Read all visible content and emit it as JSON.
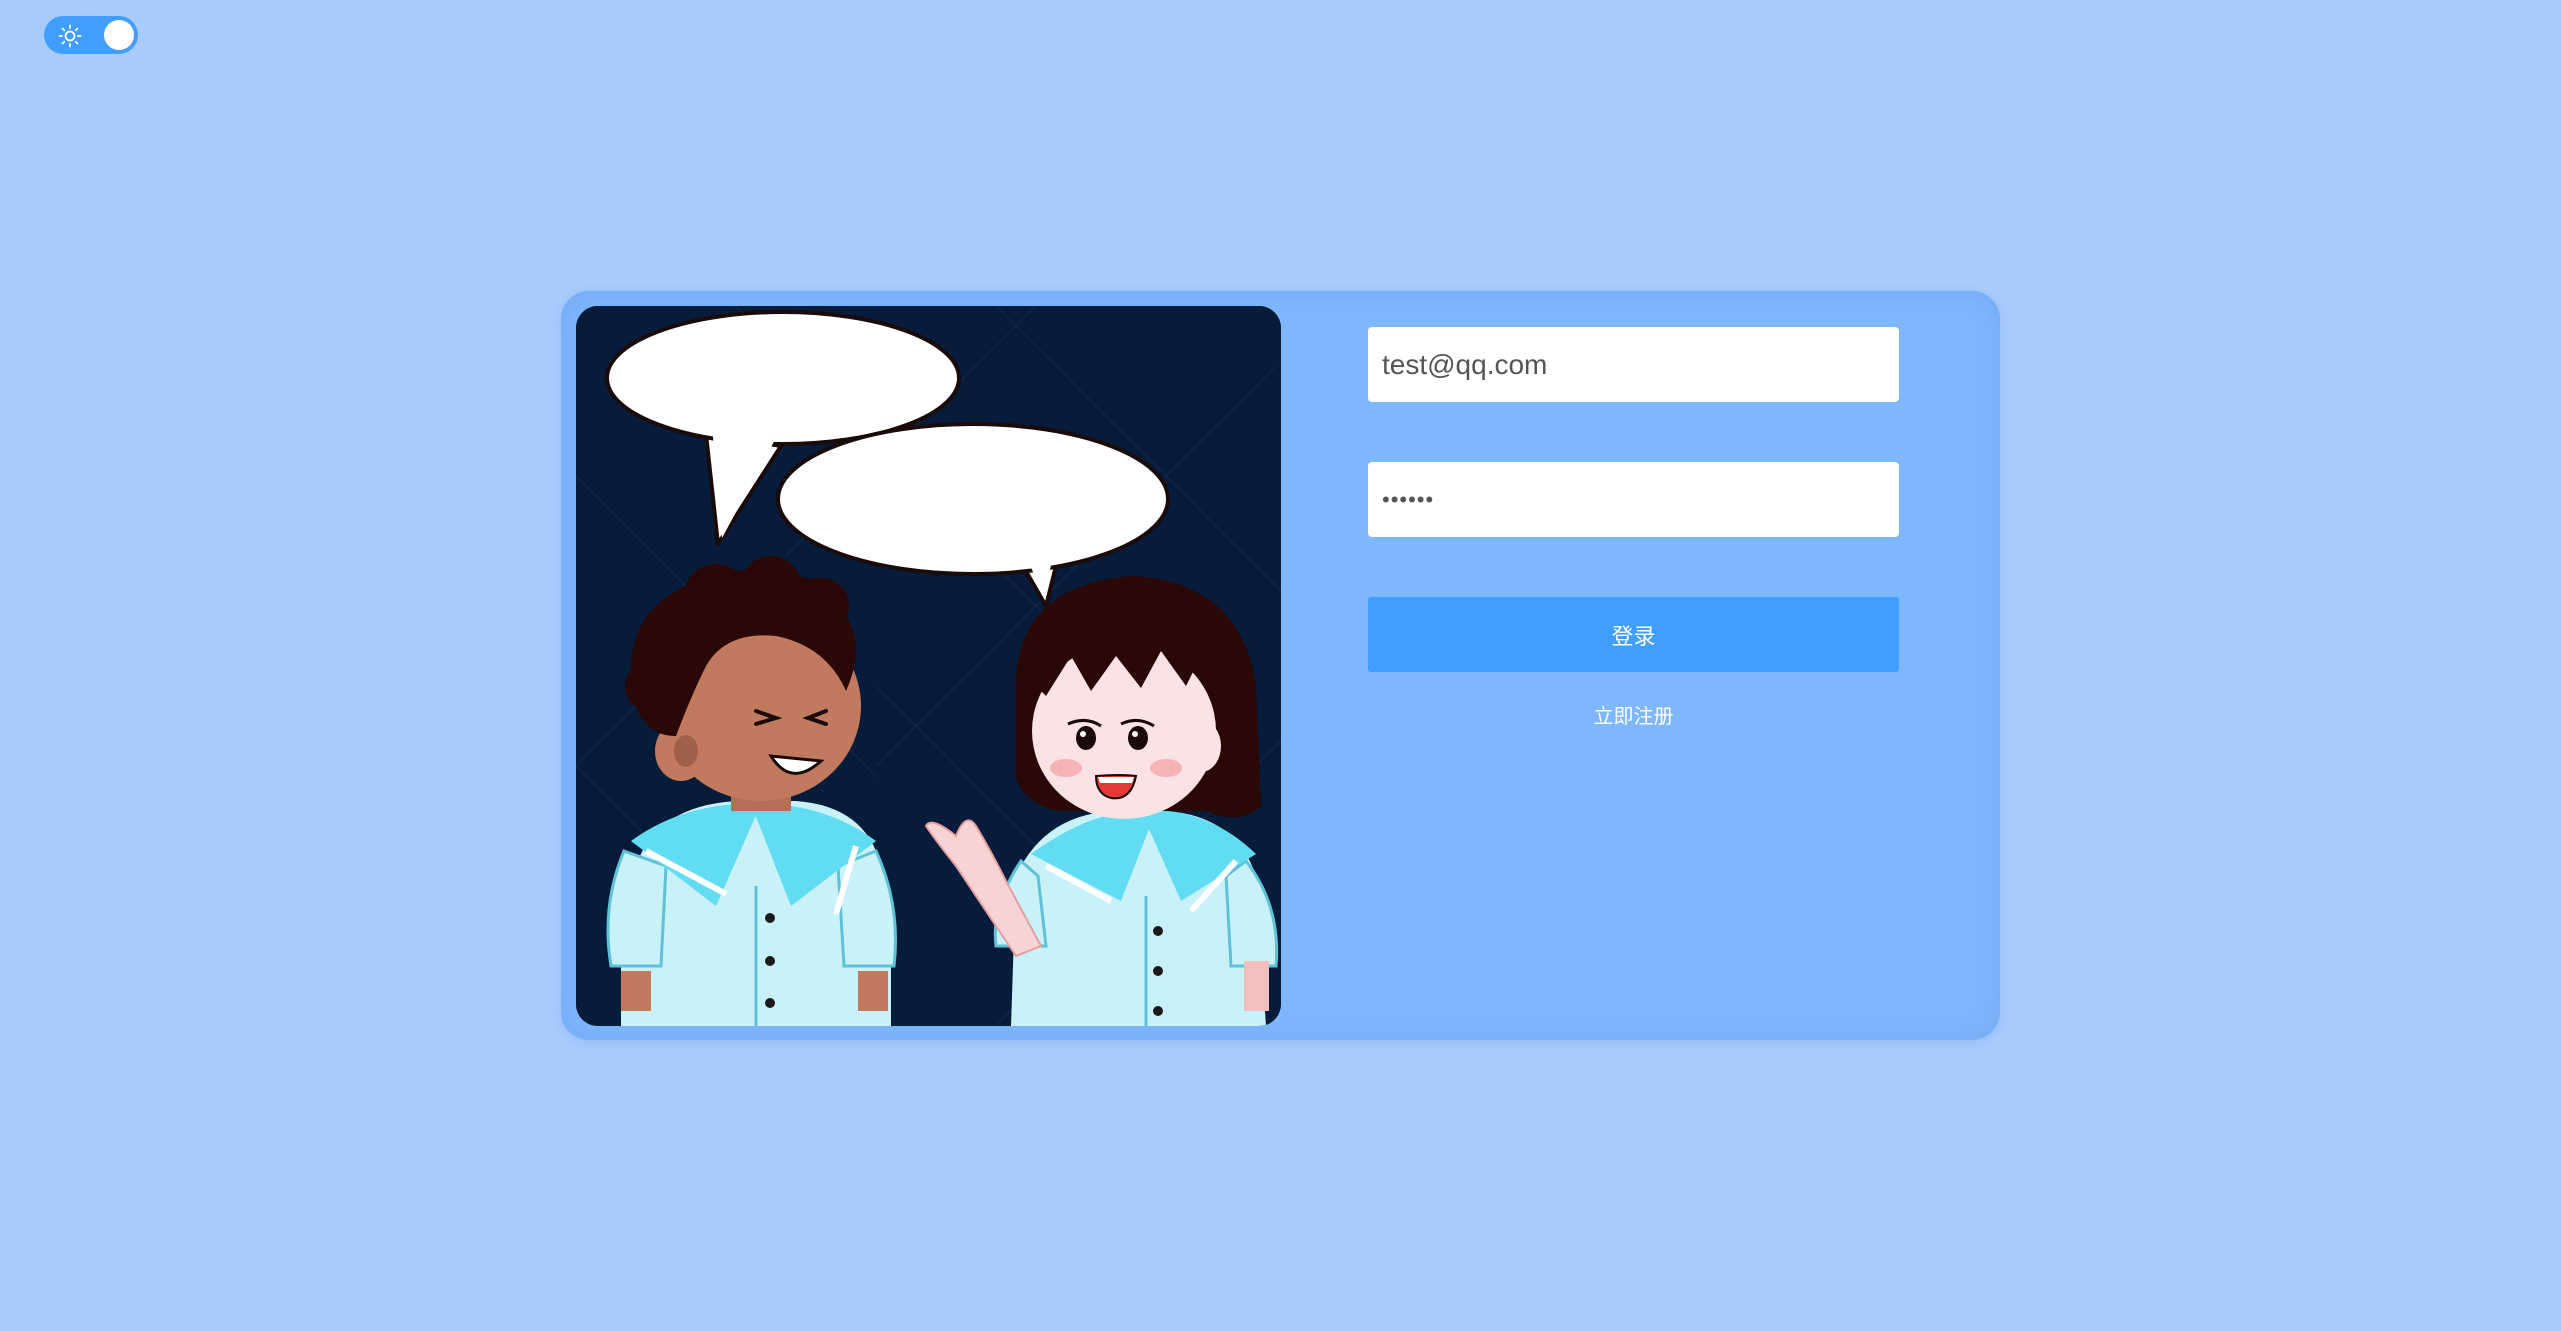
{
  "theme_toggle": {
    "icon": "sun-icon",
    "state": "light"
  },
  "login_form": {
    "email_value": "test@qq.com",
    "password_value": "••••••",
    "login_label": "登录",
    "register_label": "立即注册"
  },
  "colors": {
    "page_background": "#a8cbfc",
    "card_background": "#7fb7fc",
    "accent": "#409eff",
    "illustration_background": "#071b3a"
  }
}
